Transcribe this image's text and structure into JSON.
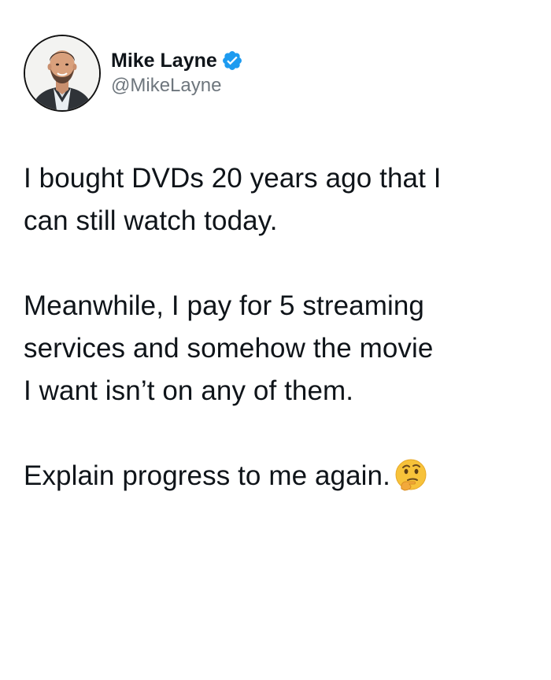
{
  "author": {
    "display_name": "Mike Layne",
    "handle": "@MikeLayne",
    "verified": true,
    "avatar_icon": "profile-photo-avatar",
    "verified_icon": "verified-badge-icon",
    "verified_color": "#1d9bf0"
  },
  "tweet": {
    "paragraphs": [
      "I bought DVDs 20 years ago that I\ncan still watch today.",
      "Meanwhile, I pay for 5 streaming\nservices and somehow the movie\nI want isn’t on any of them.",
      "Explain progress to me again."
    ],
    "trailing_emoji": "thinking-face-emoji"
  },
  "colors": {
    "text": "#0f1419",
    "handle": "#6e767d",
    "background": "#ffffff"
  }
}
